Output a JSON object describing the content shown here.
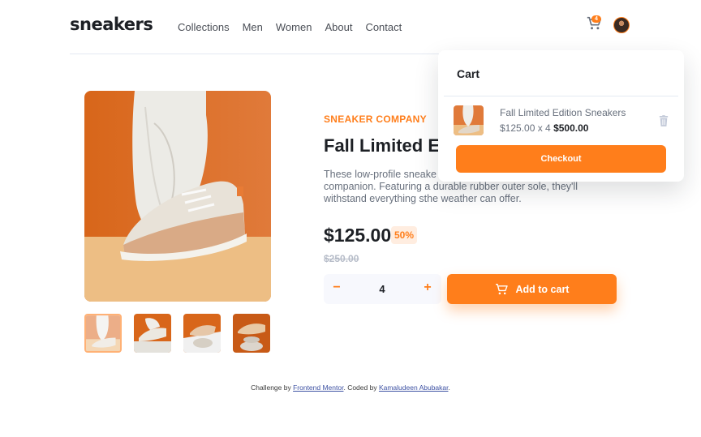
{
  "header": {
    "logo": "sneakers",
    "nav": [
      "Collections",
      "Men",
      "Women",
      "About",
      "Contact"
    ],
    "cart_count": "4"
  },
  "product": {
    "brand": "SNEAKER COMPANY",
    "title": "Fall Limited E",
    "description": "These low-profile sneake... companion. Featuring a durable rubber outer sole, they'll withstand everything sthe weather can offer.",
    "description_line1": "These low-profile sneake",
    "description_line2": "companion. Featuring a durable rubber outer sole, they'll",
    "description_line3": "withstand everything sthe weather can offer.",
    "price": "$125.00",
    "discount": "50%",
    "old_price": "$250.00",
    "quantity": "4",
    "minus": "−",
    "plus": "+",
    "add_to_cart": "Add to cart"
  },
  "cart": {
    "title": "Cart",
    "item_name": "Fall Limited Edition Sneakers",
    "item_unit": "$125.00 x 4",
    "item_total": "$500.00",
    "checkout": "Checkout"
  },
  "attribution": {
    "prefix": "Challenge by ",
    "link1": "Frontend Mentor",
    "middle": ". Coded by ",
    "link2": "Kamaludeen Abubakar",
    "suffix": "."
  },
  "colors": {
    "accent": "#ff7e1b",
    "accent_pale": "#ffede0",
    "text_dark": "#1d2025",
    "text_gray": "#68707d"
  },
  "icons": {
    "cart": "cart-icon",
    "trash": "trash-icon",
    "avatar": "avatar"
  }
}
